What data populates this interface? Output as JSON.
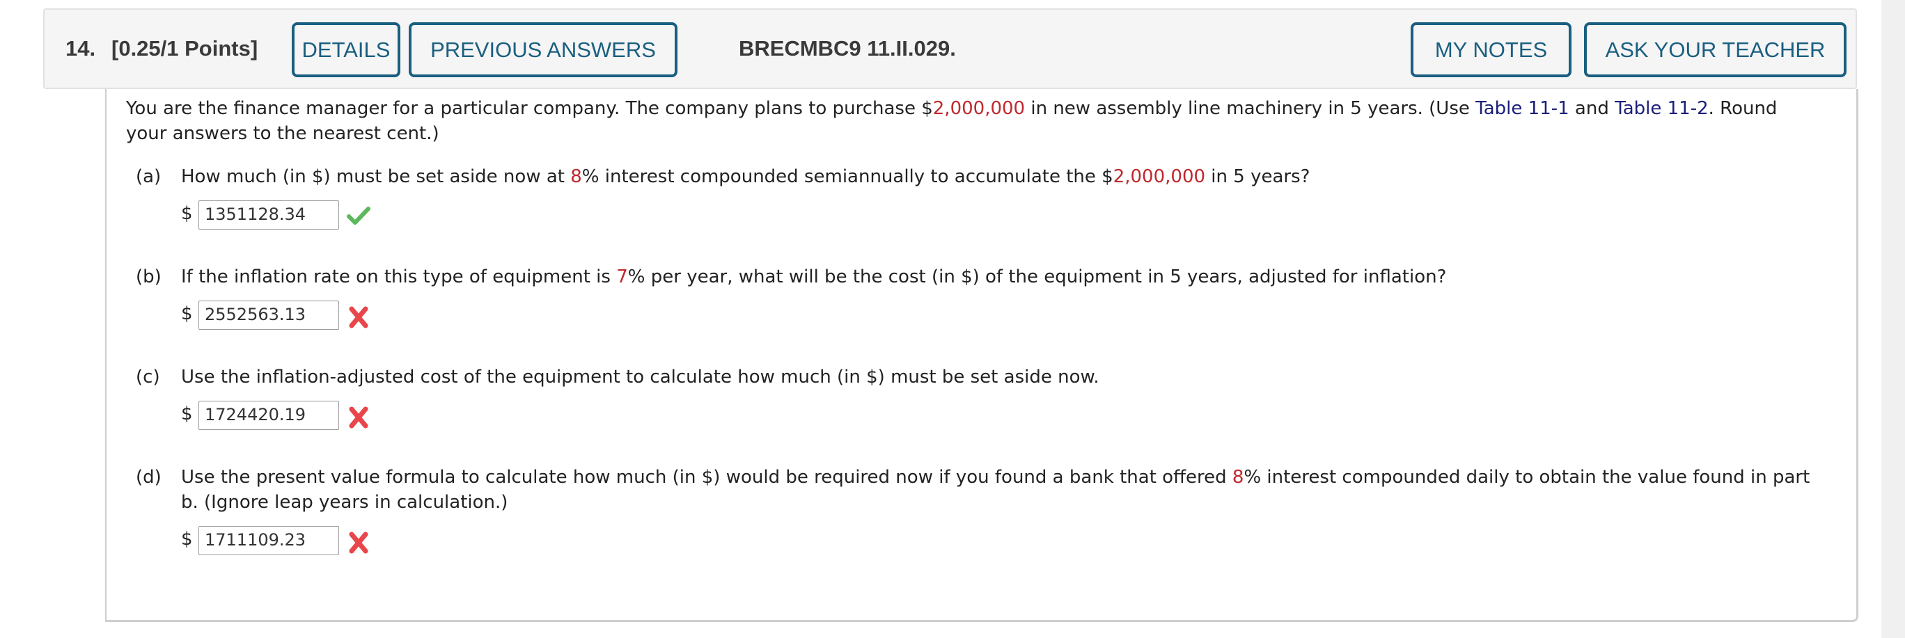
{
  "header": {
    "question_number": "14.",
    "points": "[0.25/1 Points]",
    "details_label": "DETAILS",
    "previous_answers_label": "PREVIOUS ANSWERS",
    "problem_code": "BRECMBC9 11.II.029.",
    "my_notes_label": "MY NOTES",
    "ask_teacher_label": "ASK YOUR TEACHER"
  },
  "colors": {
    "button_accent": "#1a5f80",
    "highlight_red": "#c0282d",
    "link_navy": "#1b1f7a",
    "correct_green": "#5cb85c",
    "incorrect_red": "#e8464a"
  },
  "intro": {
    "part1": "You are the finance manager for a particular company. The company plans to purchase $",
    "amount": "2,000,000",
    "part2": " in new assembly line machinery in 5 years. (Use ",
    "link1": "Table 11-1",
    "part3": " and ",
    "link2": "Table 11-2",
    "part4": ". Round",
    "line2": "your answers to the nearest cent.)"
  },
  "parts": [
    {
      "label": "(a)",
      "text_before": "How much (in $) must be set aside now at ",
      "highlight": "8",
      "text_after": "% interest compounded semiannually to accumulate the $",
      "highlight2": "2,000,000",
      "text_after2": " in 5 years?",
      "currency": "$",
      "answer": "1351128.34",
      "status": "correct",
      "status_icon": "check-icon"
    },
    {
      "label": "(b)",
      "text_before": "If the inflation rate on this type of equipment is ",
      "highlight": "7",
      "text_after": "% per year, what will be the cost (in $) of the equipment in 5 years, adjusted for inflation?",
      "currency": "$",
      "answer": "2552563.13",
      "status": "incorrect",
      "status_icon": "x-icon"
    },
    {
      "label": "(c)",
      "text_before": "Use the inflation-adjusted cost of the equipment to calculate how much (in $) must be set aside now.",
      "currency": "$",
      "answer": "1724420.19",
      "status": "incorrect",
      "status_icon": "x-icon"
    },
    {
      "label": "(d)",
      "text_before": "Use the present value formula to calculate how much (in $) would be required now if you found a bank that offered ",
      "highlight": "8",
      "text_after": "% interest compounded daily to obtain the value found in part",
      "line2": "b. (Ignore leap years in calculation.)",
      "currency": "$",
      "answer": "1711109.23",
      "status": "incorrect",
      "status_icon": "x-icon"
    }
  ]
}
